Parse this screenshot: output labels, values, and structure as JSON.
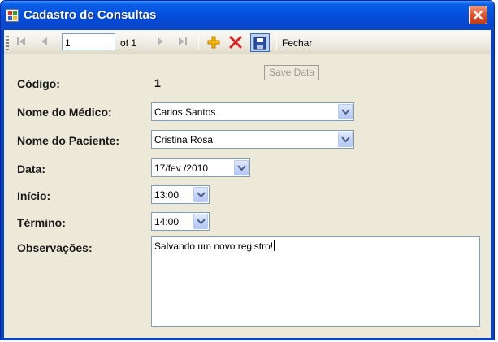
{
  "window": {
    "title": "Cadastro de Consultas"
  },
  "toolbar": {
    "position_value": "1",
    "count_label": "of 1",
    "close_label": "Fechar",
    "tooltip": "Save Data"
  },
  "form": {
    "codigo": {
      "label": "Código:",
      "value": "1"
    },
    "medico": {
      "label": "Nome do Médico:",
      "value": "Carlos Santos"
    },
    "paciente": {
      "label": "Nome do Paciente:",
      "value": "Cristina Rosa"
    },
    "data": {
      "label": "Data:",
      "value": "17/fev /2010"
    },
    "inicio": {
      "label": "Início:",
      "value": "13:00"
    },
    "termino": {
      "label": "Término:",
      "value": "14:00"
    },
    "observacoes": {
      "label": "Observações:",
      "value": "Salvando um novo registro!"
    }
  },
  "colors": {
    "titlebar": "#0553e0",
    "client_bg": "#ece9d8",
    "field_border": "#7f9db9",
    "close_red": "#e1542c",
    "add_icon": "#f2a200",
    "delete_icon": "#e02020"
  },
  "icons": [
    "app-icon",
    "close-icon",
    "move-first-icon",
    "move-previous-icon",
    "move-next-icon",
    "move-last-icon",
    "add-icon",
    "delete-icon",
    "save-icon",
    "chevron-down-icon"
  ]
}
